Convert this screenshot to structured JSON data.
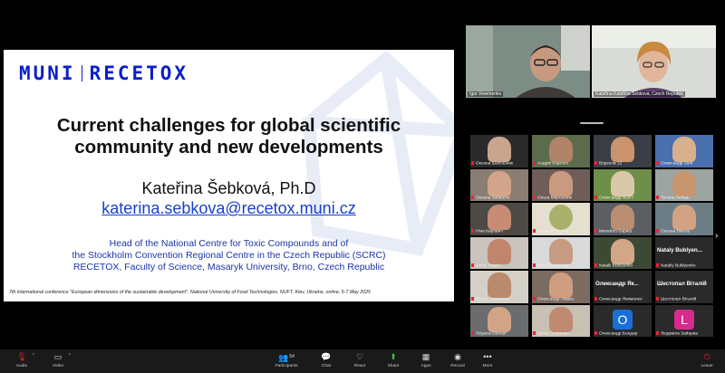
{
  "slide": {
    "logo_left": "MUNI",
    "logo_right": "RECETOX",
    "title_line1": "Current challenges for global scientific",
    "title_line2": "community and new developments",
    "author": "Kateřina Šebková, Ph.D",
    "email": "katerina.sebkova@recetox.muni.cz",
    "affiliation_line1": "Head of the National Centre for Toxic Compounds and of",
    "affiliation_line2": "the Stockholm Convention Regional Centre in the Czech Republic (SCRC)",
    "affiliation_line3": "RECETOX, Faculty of Science, Masaryk University, Brno, Czech Republic",
    "footer": "7th International conference \"European dimensions of the sustainable development\", National University of Food Technologies, NUFT, Kiev, Ukraine, online, 5-7 May 2025"
  },
  "speakers": [
    {
      "name": "Igor Veremenko"
    },
    {
      "name": "Kateřina Kateřina Šebková, Czech Republic"
    }
  ],
  "participants": [
    {
      "name": "Оксана Шапошник"
    },
    {
      "name": "Андрій Коротко"
    },
    {
      "name": "Ворскла 12"
    },
    {
      "name": "Олександр Залі"
    },
    {
      "name": "Оксана Забашта"
    },
    {
      "name": "Ольга Мирошник"
    },
    {
      "name": "Олександр NUFT"
    },
    {
      "name": "Тетяна Лебідь"
    },
    {
      "name": "Ніна Кирович"
    },
    {
      "name": "Наталія Кравче"
    },
    {
      "name": "Михайло Бариш"
    },
    {
      "name": "Оксана Ніколь"
    },
    {
      "name": "Алла Таран"
    },
    {
      "name": "Vasyl Pasichnyk"
    },
    {
      "name": "Natalii Bublyenko"
    },
    {
      "name": "Nataliy Bublyenko",
      "label": "Nataly Bublyen..."
    },
    {
      "name": "Віктор Тютюнник"
    },
    {
      "name": "Олександр Ляшко"
    },
    {
      "name": "Олександр Якименко",
      "label": "Олександр Як..."
    },
    {
      "name": "Шестопал Віталій",
      "label": "Шестопал Віталій"
    },
    {
      "name": "Tetyana Osman"
    },
    {
      "name": "Ірина Осипенко"
    },
    {
      "name": "Олександр Бондар",
      "initial": "O",
      "initial_color": "#1a6fd8"
    },
    {
      "name": "Людмила Зайцева",
      "initial": "L",
      "initial_color": "#d62b8f"
    }
  ],
  "toolbar": {
    "audio": "Audio",
    "video": "Video",
    "participants": "Participants",
    "participants_count": "54",
    "chat": "Chat",
    "react": "React",
    "share": "Share",
    "apps": "Apps",
    "record": "Record",
    "more": "More",
    "leave": "Leave"
  },
  "colors": {
    "brand_blue": "#0a1ecc",
    "share_green": "#2ecc40",
    "leave_red": "#e02020"
  }
}
